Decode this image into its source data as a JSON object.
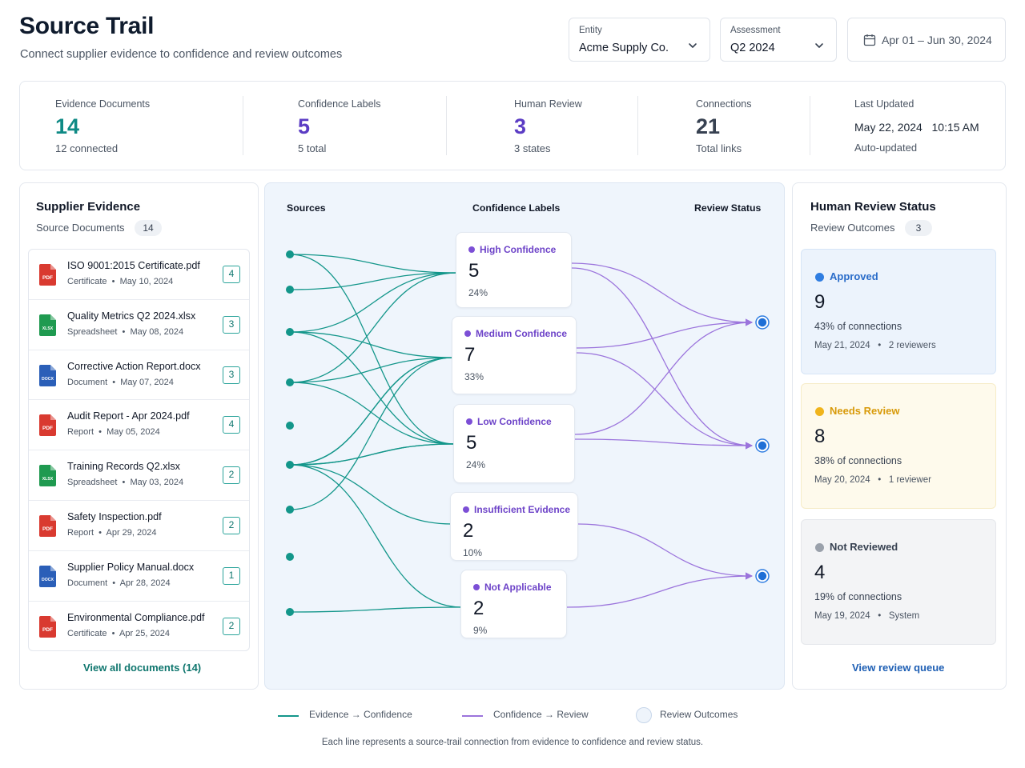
{
  "header": {
    "title": "Source Trail",
    "subtitle": "Connect supplier evidence to confidence and review outcomes",
    "entity": {
      "label": "Entity",
      "value": "Acme Supply Co."
    },
    "assessment": {
      "label": "Assessment",
      "value": "Q2 2024"
    },
    "date_range": "Apr 01 – Jun 30, 2024"
  },
  "stats": [
    {
      "label": "Evidence Documents",
      "value": "14",
      "sub": "12 connected",
      "color": "#0f8a85"
    },
    {
      "label": "Confidence Labels",
      "value": "5",
      "sub": "5 total",
      "color": "#5b3cc4"
    },
    {
      "label": "Human Review",
      "value": "3",
      "sub": "3 states",
      "color": "#5b3cc4"
    },
    {
      "label": "Connections",
      "value": "21",
      "sub": "Total links",
      "color": "#374151"
    },
    {
      "label": "Last Updated",
      "value": "May 22, 2024   10:15 AM",
      "sub": "Auto-updated",
      "color": "#111827"
    }
  ],
  "evidence": {
    "title": "Supplier Evidence",
    "subtitle": "Source Documents",
    "count": "14",
    "documents": [
      {
        "name": "ISO 9001:2015 Certificate.pdf",
        "type": "Certificate",
        "date": "May 10, 2024",
        "links": "4",
        "icon": "pdf-file-icon",
        "badge": "PDF",
        "color": "#d93a30"
      },
      {
        "name": "Quality Metrics Q2 2024.xlsx",
        "type": "Spreadsheet",
        "date": "May 08, 2024",
        "links": "3",
        "icon": "xlsx-file-icon",
        "badge": "XLSX",
        "color": "#1f9a50"
      },
      {
        "name": "Corrective Action Report.docx",
        "type": "Document",
        "date": "May 07, 2024",
        "links": "3",
        "icon": "docx-file-icon",
        "badge": "DOCX",
        "color": "#2b5fb8"
      },
      {
        "name": "Audit Report - Apr 2024.pdf",
        "type": "Report",
        "date": "May 05, 2024",
        "links": "4",
        "icon": "pdf-file-icon",
        "badge": "PDF",
        "color": "#d93a30"
      },
      {
        "name": "Training Records Q2.xlsx",
        "type": "Spreadsheet",
        "date": "May 03, 2024",
        "links": "2",
        "icon": "xlsx-file-icon",
        "badge": "XLSX",
        "color": "#1f9a50"
      },
      {
        "name": "Safety Inspection.pdf",
        "type": "Report",
        "date": "Apr 29, 2024",
        "links": "2",
        "icon": "pdf-file-icon",
        "badge": "PDF",
        "color": "#d93a30"
      },
      {
        "name": "Supplier Policy Manual.docx",
        "type": "Document",
        "date": "Apr 28, 2024",
        "links": "1",
        "icon": "docx-file-icon",
        "badge": "DOCX",
        "color": "#2b5fb8"
      },
      {
        "name": "Environmental Compliance.pdf",
        "type": "Certificate",
        "date": "Apr 25, 2024",
        "links": "2",
        "icon": "pdf-file-icon",
        "badge": "PDF",
        "color": "#d93a30"
      }
    ],
    "view_all": "View all documents (14)"
  },
  "flow": {
    "col_sources": "Sources",
    "col_confidence": "Confidence Labels",
    "col_review": "Review Status",
    "confidence": [
      {
        "name": "High Confidence",
        "value": "5",
        "pct": "24%"
      },
      {
        "name": "Medium Confidence",
        "value": "7",
        "pct": "33%"
      },
      {
        "name": "Low Confidence",
        "value": "5",
        "pct": "24%"
      },
      {
        "name": "Insufficient Evidence",
        "value": "2",
        "pct": "10%"
      },
      {
        "name": "Not Applicable",
        "value": "2",
        "pct": "9%"
      }
    ],
    "evidence_links": [
      [
        0,
        0
      ],
      [
        0,
        2
      ],
      [
        1,
        0
      ],
      [
        2,
        0
      ],
      [
        2,
        1
      ],
      [
        2,
        2
      ],
      [
        3,
        1
      ],
      [
        3,
        0
      ],
      [
        3,
        2
      ],
      [
        4,
        1
      ],
      [
        4,
        2
      ],
      [
        5,
        1
      ],
      [
        5,
        2
      ],
      [
        5,
        3
      ],
      [
        5,
        4
      ],
      [
        6,
        1
      ],
      [
        7,
        4
      ]
    ],
    "review_links": [
      [
        0,
        0
      ],
      [
        0,
        1
      ],
      [
        1,
        0
      ],
      [
        1,
        1
      ],
      [
        2,
        0
      ],
      [
        2,
        1
      ],
      [
        3,
        2
      ],
      [
        4,
        2
      ]
    ],
    "evidence_color": "#13968a",
    "review_color": "#9b74dc"
  },
  "review": {
    "title": "Human Review Status",
    "subtitle": "Review Outcomes",
    "count": "3",
    "statuses": [
      {
        "name": "Approved",
        "value": "9",
        "pct": "43% of connections",
        "date": "May 21, 2024",
        "who": "2 reviewers",
        "dot": "#2f7de1",
        "text": "#2a6cc9",
        "bg": "#ecf3fc",
        "border": "#d6e5f7"
      },
      {
        "name": "Needs Review",
        "value": "8",
        "pct": "38% of connections",
        "date": "May 20, 2024",
        "who": "1 reviewer",
        "dot": "#f0b41c",
        "text": "#d89a0a",
        "bg": "#fefaec",
        "border": "#f6ecc7"
      },
      {
        "name": "Not Reviewed",
        "value": "4",
        "pct": "19% of connections",
        "date": "May 19, 2024",
        "who": "System",
        "dot": "#9aa1ab",
        "text": "#374151",
        "bg": "#f3f4f6",
        "border": "#e5e7eb"
      }
    ],
    "view_queue": "View review queue"
  },
  "legend": {
    "evidence": "Evidence → Confidence",
    "review": "Confidence → Review",
    "outcomes": "Review Outcomes"
  },
  "footnote": "Each line represents a source-trail connection from evidence to confidence and review status."
}
